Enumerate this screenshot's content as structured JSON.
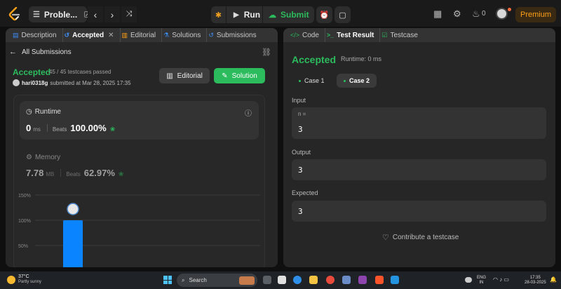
{
  "topbar": {
    "problem_label": "Proble...",
    "run_label": "Run",
    "submit_label": "Submit",
    "streak_count": "0",
    "premium_label": "Premium"
  },
  "left_tabs": [
    {
      "label": "Description",
      "icon": "description-icon"
    },
    {
      "label": "Accepted",
      "icon": "history-icon",
      "closable": true,
      "active": true
    },
    {
      "label": "Editorial",
      "icon": "book-icon"
    },
    {
      "label": "Solutions",
      "icon": "flask-icon"
    },
    {
      "label": "Submissions",
      "icon": "history-icon"
    }
  ],
  "submission": {
    "back_label": "All Submissions",
    "status": "Accepted",
    "testcases": "45 / 45 testcases passed",
    "username": "hari0318g",
    "submitted_text": "submitted at Mar 28, 2025 17:35",
    "editorial_label": "Editorial",
    "solution_label": "Solution"
  },
  "runtime": {
    "label": "Runtime",
    "value": "0",
    "unit": "ms",
    "beats_label": "Beats",
    "beats_pct": "100.00%"
  },
  "memory": {
    "label": "Memory",
    "value": "7.78",
    "unit": "MB",
    "beats_label": "Beats",
    "beats_pct": "62.97%"
  },
  "chart_data": {
    "type": "bar",
    "ytick_labels": [
      "150%",
      "100%",
      "50%"
    ],
    "yticks": [
      150,
      100,
      50
    ],
    "values": [
      100
    ],
    "accent": "#0a84ff",
    "grid": true
  },
  "right_tabs": [
    {
      "label": "Code",
      "icon": "code-icon"
    },
    {
      "label": "Test Result",
      "icon": "terminal-icon",
      "active": true
    },
    {
      "label": "Testcase",
      "icon": "checkbox-icon"
    }
  ],
  "result": {
    "status": "Accepted",
    "runtime_text": "Runtime: 0 ms",
    "cases": [
      "Case 1",
      "Case 2"
    ],
    "input_label": "Input",
    "input_name": "n =",
    "input_value": "3",
    "output_label": "Output",
    "output_value": "3",
    "expected_label": "Expected",
    "expected_value": "3",
    "contribute_label": "Contribute a testcase"
  },
  "taskbar": {
    "temp": "37°C",
    "weather": "Partly sunny",
    "search_placeholder": "Search",
    "lang1": "ENG",
    "lang2": "IN",
    "time": "17:35",
    "date": "28-03-2025"
  },
  "colors": {
    "accent_green": "#2cbb5d",
    "premium_orange": "#ffa116",
    "bar_blue": "#0a84ff"
  }
}
